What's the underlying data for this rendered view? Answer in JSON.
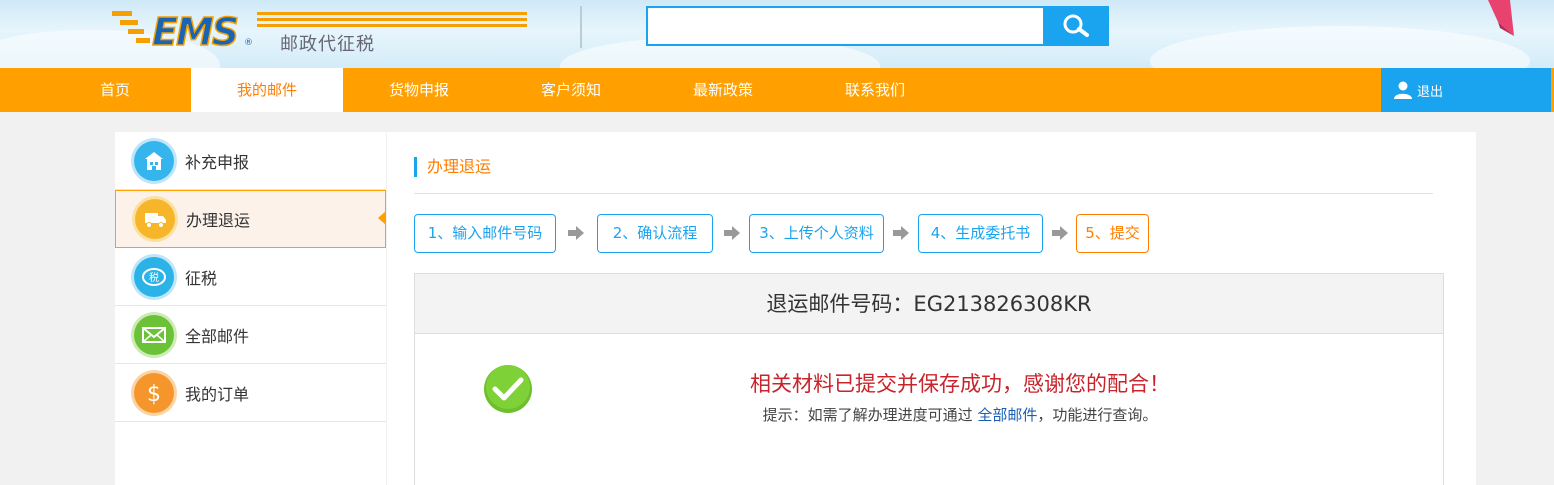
{
  "header": {
    "site_name": "邮政代征税",
    "logo_text": "EMS",
    "search": {
      "value": "",
      "placeholder": ""
    }
  },
  "nav": {
    "items": [
      {
        "label": "首页"
      },
      {
        "label": "我的邮件",
        "active": true
      },
      {
        "label": "货物申报"
      },
      {
        "label": "客户须知"
      },
      {
        "label": "最新政策"
      },
      {
        "label": "联系我们"
      }
    ],
    "logout_label": "退出"
  },
  "sidebar": {
    "items": [
      {
        "label": "补充申报",
        "icon": "building-icon",
        "color": "#35b5ee"
      },
      {
        "label": "办理退运",
        "icon": "truck-icon",
        "color": "#f7b529",
        "active": true
      },
      {
        "label": "征税",
        "icon": "tax-icon",
        "color": "#2bb3e8"
      },
      {
        "label": "全部邮件",
        "icon": "mail-icon",
        "color": "#6cc237"
      },
      {
        "label": "我的订单",
        "icon": "dollar-icon",
        "color": "#f5962c"
      }
    ]
  },
  "main": {
    "section_title": "办理退运",
    "steps": [
      {
        "label": "1、输入邮件号码"
      },
      {
        "label": "2、确认流程"
      },
      {
        "label": "3、上传个人资料"
      },
      {
        "label": "4、生成委托书"
      },
      {
        "label": "5、提交",
        "current": true
      }
    ],
    "tracking_label": "退运邮件号码：EG213826308KR",
    "success_message": "相关材料已提交并保存成功，感谢您的配合！",
    "hint_prefix": "提示：如需了解办理进度可通过",
    "hint_link": "全部邮件",
    "hint_suffix": "，功能进行查询。"
  },
  "colors": {
    "nav_orange": "#ff9f00",
    "accent_blue": "#1aa3ee",
    "active_orange": "#ff7e00",
    "success_red": "#c8242b"
  }
}
